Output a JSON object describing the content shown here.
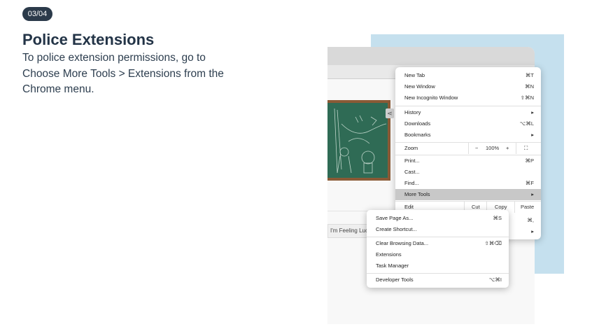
{
  "badge": "03/04",
  "title": "Police Extensions",
  "description": "To police extension permissions, go to Choose More Tools > Extensions from the Chrome menu.",
  "colors": {
    "badge_bg": "#2b3a4a",
    "title": "#233447",
    "accent_bg": "#c5e0ee",
    "highlight": "#c8c8c8"
  },
  "browser": {
    "search_button": "I'm Feeling Lucky"
  },
  "menu": {
    "new_tab": {
      "label": "New Tab",
      "shortcut": "⌘T"
    },
    "new_window": {
      "label": "New Window",
      "shortcut": "⌘N"
    },
    "new_incognito": {
      "label": "New Incognito Window",
      "shortcut": "⇧⌘N"
    },
    "history": {
      "label": "History",
      "arrow": "▸"
    },
    "downloads": {
      "label": "Downloads",
      "shortcut": "⌥⌘L"
    },
    "bookmarks": {
      "label": "Bookmarks",
      "arrow": "▸"
    },
    "zoom": {
      "label": "Zoom",
      "minus": "−",
      "value": "100%",
      "plus": "+",
      "fullscreen": "⛶"
    },
    "print": {
      "label": "Print...",
      "shortcut": "⌘P"
    },
    "cast": {
      "label": "Cast..."
    },
    "find": {
      "label": "Find...",
      "shortcut": "⌘F"
    },
    "more_tools": {
      "label": "More Tools",
      "arrow": "▸"
    },
    "edit": {
      "label": "Edit",
      "cut": "Cut",
      "copy": "Copy",
      "paste": "Paste"
    },
    "settings_shortcut": "⌘,",
    "help_arrow": "▸"
  },
  "submenu": {
    "save_page": {
      "label": "Save Page As...",
      "shortcut": "⌘S"
    },
    "create_shortcut": {
      "label": "Create Shortcut..."
    },
    "clear_browsing": {
      "label": "Clear Browsing Data...",
      "shortcut": "⇧⌘⌫"
    },
    "extensions": {
      "label": "Extensions"
    },
    "task_manager": {
      "label": "Task Manager"
    },
    "developer_tools": {
      "label": "Developer Tools",
      "shortcut": "⌥⌘I"
    }
  }
}
